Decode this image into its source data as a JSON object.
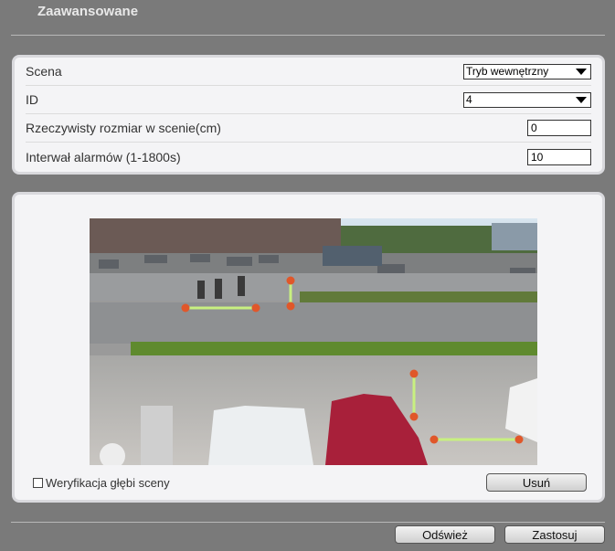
{
  "header": {
    "title": "Zaawansowane"
  },
  "settings": {
    "scene_label": "Scena",
    "scene_value": "Tryb wewnętrzny",
    "id_label": "ID",
    "id_value": "4",
    "size_label": "Rzeczywisty rozmiar w scenie(cm)",
    "size_value": "0",
    "interval_label": "Interwał alarmów (1-1800s)",
    "interval_value": "10"
  },
  "preview": {
    "depth_verification_label": "Weryfikacja głębi sceny",
    "depth_verification_checked": false,
    "delete_label": "Usuń"
  },
  "footer": {
    "refresh_label": "Odśwież",
    "apply_label": "Zastosuj"
  },
  "colors": {
    "marker_line": "#c8f080",
    "marker_point": "#e0572a",
    "background": "#7a7a7a",
    "panel": "#f4f4f6"
  }
}
